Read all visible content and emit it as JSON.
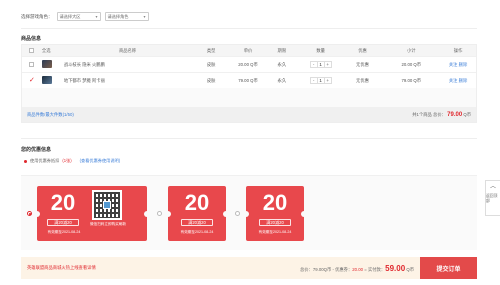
{
  "selectors": {
    "label": "选择游戏角色：",
    "server_placeholder": "请选择大区",
    "role_placeholder": "请选择角色"
  },
  "goods": {
    "section_title": "商品信息",
    "columns": [
      "全选",
      "商品名称",
      "类型",
      "单价",
      "期限",
      "数量",
      "优惠",
      "小计",
      "操作"
    ],
    "rows": [
      {
        "name": "战斗枝长 隐米 火鹏鹏",
        "type": "皮肤",
        "price": "20.00 Q币",
        "term": "永久",
        "qty": "1",
        "discount": "无优惠",
        "subtotal": "20.00 Q币",
        "op_follow": "关注",
        "op_delete": "删除",
        "checked": false
      },
      {
        "name": "地下都市 梦魇 阿卡丽",
        "type": "皮肤",
        "price": "79.00 Q币",
        "term": "永久",
        "qty": "1",
        "discount": "无优惠",
        "subtotal": "79.00 Q币",
        "op_follow": "关注",
        "op_delete": "删除",
        "checked": true
      }
    ],
    "selected_count": "商品件数/最大件数(1/50)",
    "total_prefix": "共1个商品 总价：",
    "total_amount": "79.00",
    "total_unit": "Q币"
  },
  "coupons": {
    "section_title": "您的优惠信息",
    "tip_label": "使用优惠券抵扣",
    "tip_count": "(1张)",
    "tip_link": "(查看优惠券使用说明)",
    "items": [
      {
        "amount": "20",
        "condition": "满20减20",
        "valid": "有效期至2021-08-24",
        "qr_text": "微信扫码立即购买刷新",
        "selected": true
      },
      {
        "amount": "20",
        "condition": "满20减20",
        "valid": "有效期至2021-08-24",
        "selected": false
      },
      {
        "amount": "20",
        "condition": "满20减20",
        "valid": "有效期至2021-08-24",
        "selected": false
      }
    ]
  },
  "bottom": {
    "notice": "英雄联盟商品商城火热上线查看详情",
    "total_label": "总价：",
    "total_value": "79.00",
    "discount_label": "- 优惠券：",
    "discount_value": "20.00",
    "paid_label": "= 实付款：",
    "paid_value": "59.00",
    "unit": "Q币",
    "submit_label": "提交订单"
  },
  "float_tab": {
    "label": "返回顶部"
  }
}
